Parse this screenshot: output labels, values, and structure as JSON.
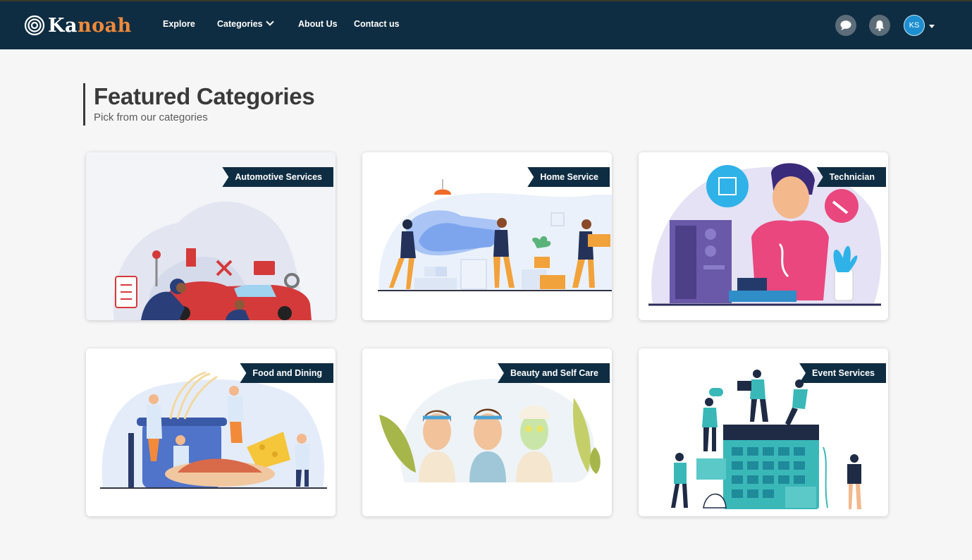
{
  "brand": {
    "logo_prefix": "Ka",
    "logo_suffix": "noah"
  },
  "nav": {
    "links": [
      "Explore",
      "Categories",
      "About Us",
      "Contact us"
    ],
    "user_initials": "KS",
    "icons": [
      "chat-icon",
      "bell-icon",
      "avatar",
      "caret-down-icon"
    ]
  },
  "heading": {
    "title": "Featured Categories",
    "subtitle": "Pick from our categories"
  },
  "categories": [
    {
      "label": "Automotive Services",
      "illustration": "car-repair"
    },
    {
      "label": "Home Service",
      "illustration": "movers-with-couch"
    },
    {
      "label": "Technician",
      "illustration": "computer-technician"
    },
    {
      "label": "Food and Dining",
      "illustration": "chefs-cooking-pasta"
    },
    {
      "label": "Beauty and Self Care",
      "illustration": "women-with-face-masks"
    },
    {
      "label": "Event Services",
      "illustration": "people-with-calendar"
    }
  ],
  "colors": {
    "navbar": "#0f2d42",
    "accent": "#f08a3a",
    "avatar": "#1d8fd0",
    "page_bg": "#f6f6f7"
  }
}
